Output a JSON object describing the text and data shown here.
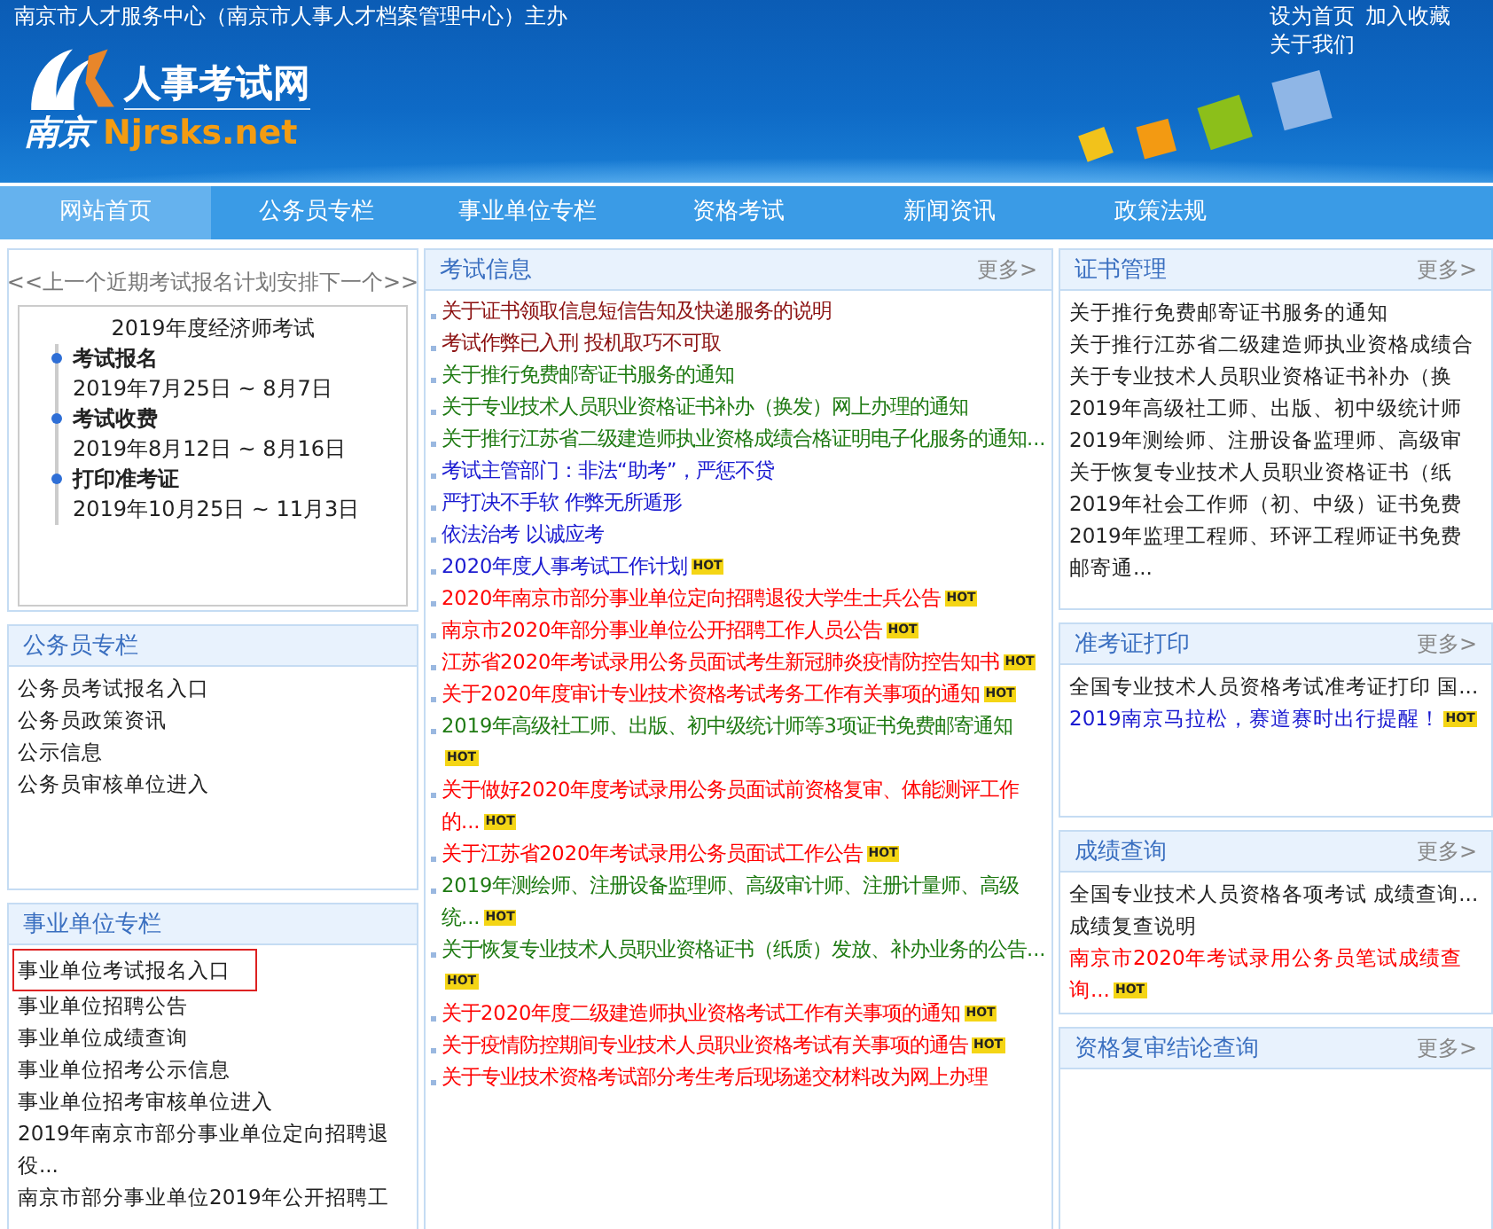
{
  "header": {
    "sponsor": "南京市人才服务中心（南京市人事人才档案管理中心）主办",
    "links": [
      "设为首页",
      "加入收藏",
      "关于我们"
    ],
    "logo": {
      "name": "人事考试网",
      "city": "南京",
      "domain": "Njrsks.net"
    }
  },
  "nav": [
    {
      "label": "网站首页",
      "selected": true
    },
    {
      "label": "公务员专栏",
      "selected": false
    },
    {
      "label": "事业单位专栏",
      "selected": false
    },
    {
      "label": "资格考试",
      "selected": false
    },
    {
      "label": "新闻资讯",
      "selected": false
    },
    {
      "label": "政策法规",
      "selected": false
    }
  ],
  "schedule": {
    "prev": "<<上一个",
    "title": "近期考试报名计划安排",
    "next": "下一个>>",
    "exam": "2019年度经济师考试",
    "steps": [
      {
        "name": "考试报名",
        "dates": "2019年7月25日 ~ 8月7日"
      },
      {
        "name": "考试收费",
        "dates": "2019年8月12日 ~ 8月16日"
      },
      {
        "name": "打印准考证",
        "dates": "2019年10月25日 ~ 11月3日"
      }
    ]
  },
  "left_panels": [
    {
      "title": "公务员专栏",
      "items": [
        {
          "text": "公务员考试报名入口",
          "highlighted": false
        },
        {
          "text": "公务员政策资讯",
          "highlighted": false
        },
        {
          "text": "公示信息",
          "highlighted": false
        },
        {
          "text": "公务员审核单位进入",
          "highlighted": false
        }
      ]
    },
    {
      "title": "事业单位专栏",
      "items": [
        {
          "text": "事业单位考试报名入口",
          "highlighted": true
        },
        {
          "text": "事业单位招聘公告",
          "highlighted": false
        },
        {
          "text": "事业单位成绩查询",
          "highlighted": false
        },
        {
          "text": "事业单位招考公示信息",
          "highlighted": false
        },
        {
          "text": "事业单位招考审核单位进入",
          "highlighted": false
        },
        {
          "text": "2019年南京市部分事业单位定向招聘退役...",
          "highlighted": false
        },
        {
          "text": "南京市部分事业单位2019年公开招聘工",
          "highlighted": false
        }
      ]
    }
  ],
  "middle_panel": {
    "title": "考试信息",
    "more": "更多>",
    "items": [
      {
        "text": "关于证书领取信息短信告知及快递服务的说明",
        "color": "#8b1010"
      },
      {
        "text": "考试作弊已入刑 投机取巧不可取",
        "color": "#8b1010"
      },
      {
        "text": "关于推行免费邮寄证书服务的通知",
        "color": "#1e7a12"
      },
      {
        "text": "关于专业技术人员职业资格证书补办（换发）网上办理的通知",
        "color": "#1e7a12"
      },
      {
        "text": "关于推行江苏省二级建造师执业资格成绩合格证明电子化服务的通知...",
        "color": "#1e7a12"
      },
      {
        "text": "考试主管部门：非法“助考”，严惩不贷",
        "color": "#1a1ad0"
      },
      {
        "text": "严打决不手软 作弊无所遁形",
        "color": "#1a1ad0"
      },
      {
        "text": "依法治考 以诚应考",
        "color": "#1a1ad0"
      },
      {
        "text": "2020年度人事考试工作计划",
        "color": "#1a1ad0",
        "badge": "HOT"
      },
      {
        "text": "2020年南京市部分事业单位定向招聘退役大学生士兵公告",
        "color": "#ff0000",
        "badge": "HOT"
      },
      {
        "text": "南京市2020年部分事业单位公开招聘工作人员公告",
        "color": "#ff0000",
        "badge": "HOT"
      },
      {
        "text": "江苏省2020年考试录用公务员面试考生新冠肺炎疫情防控告知书",
        "color": "#ff0000",
        "badge": "HOT"
      },
      {
        "text": "关于2020年度审计专业技术资格考试考务工作有关事项的通知",
        "color": "#ff0000",
        "badge": "HOT"
      },
      {
        "text": "2019年高级社工师、出版、初中级统计师等3项证书免费邮寄通知",
        "color": "#1e7a12",
        "badge": "HOT"
      },
      {
        "text": "关于做好2020年度考试录用公务员面试前资格复审、体能测评工作的...",
        "color": "#ff0000",
        "badge": "HOT"
      },
      {
        "text": "关于江苏省2020年考试录用公务员面试工作公告",
        "color": "#ff0000",
        "badge": "HOT"
      },
      {
        "text": "2019年测绘师、注册设备监理师、高级审计师、注册计量师、高级统...",
        "color": "#1e7a12",
        "badge": "HOT"
      },
      {
        "text": "关于恢复专业技术人员职业资格证书（纸质）发放、补办业务的公告...",
        "color": "#1e7a12",
        "badge": "HOT"
      },
      {
        "text": "关于2020年度二级建造师执业资格考试工作有关事项的通知",
        "color": "#ff0000",
        "badge": "HOT"
      },
      {
        "text": "关于疫情防控期间专业技术人员职业资格考试有关事项的通告",
        "color": "#ff0000",
        "badge": "HOT"
      },
      {
        "text": "关于专业技术资格考试部分考生考后现场递交材料改为网上办理",
        "color": "#ff0000"
      }
    ]
  },
  "right_panels": [
    {
      "title": "证书管理",
      "more": "更多>",
      "items": [
        {
          "text": "关于推行免费邮寄证书服务的通知",
          "color": "#222222"
        },
        {
          "text": "关于推行江苏省二级建造师执业资格成绩合",
          "color": "#222222"
        },
        {
          "text": "关于专业技术人员职业资格证书补办（换",
          "color": "#222222"
        },
        {
          "text": "2019年高级社工师、出版、初中级统计师",
          "color": "#222222"
        },
        {
          "text": "2019年测绘师、注册设备监理师、高级审",
          "color": "#222222"
        },
        {
          "text": "关于恢复专业技术人员职业资格证书（纸",
          "color": "#222222"
        },
        {
          "text": "2019年社会工作师（初、中级）证书免费",
          "color": "#222222"
        },
        {
          "text": "2019年监理工程师、环评工程师证书免费邮寄通...",
          "color": "#222222"
        }
      ]
    },
    {
      "title": "准考证打印",
      "more": "更多>",
      "items": [
        {
          "text": "全国专业技术人员资格考试准考证打印 国...",
          "color": "#222222"
        },
        {
          "text": "2019南京马拉松，赛道赛时出行提醒！",
          "color": "#1a1ad0",
          "badge": "HOT"
        }
      ]
    },
    {
      "title": "成绩查询",
      "more": "更多>",
      "items": [
        {
          "text": "全国专业技术人员资格各项考试 成绩查询...",
          "color": "#222222"
        },
        {
          "text": "成绩复查说明",
          "color": "#222222"
        },
        {
          "text": "南京市2020年考试录用公务员笔试成绩查询...",
          "color": "#ff0000",
          "badge": "HOT"
        }
      ]
    },
    {
      "title": "资格复审结论查询",
      "more": "更多>"
    }
  ]
}
